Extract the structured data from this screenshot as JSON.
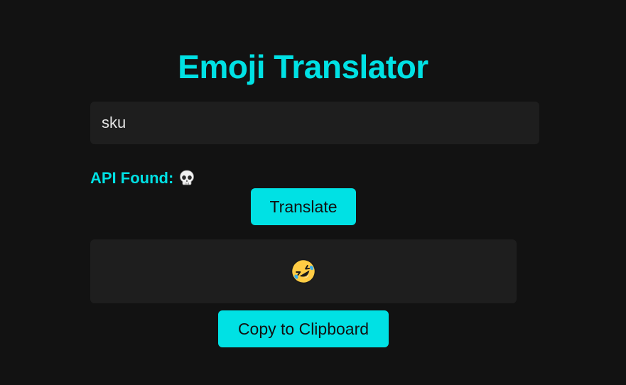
{
  "app": {
    "title": "Emoji Translator"
  },
  "input": {
    "value": "sku"
  },
  "api_status": {
    "label": "API Found:",
    "icon": "skull-icon"
  },
  "translate_button": {
    "label": "Translate"
  },
  "output": {
    "emoji": "rolling-on-floor-laughing-emoji"
  },
  "copy_button": {
    "label": "Copy to Clipboard"
  },
  "colors": {
    "accent": "#00e1e4",
    "background": "#121212",
    "surface": "#1e1e1e"
  }
}
